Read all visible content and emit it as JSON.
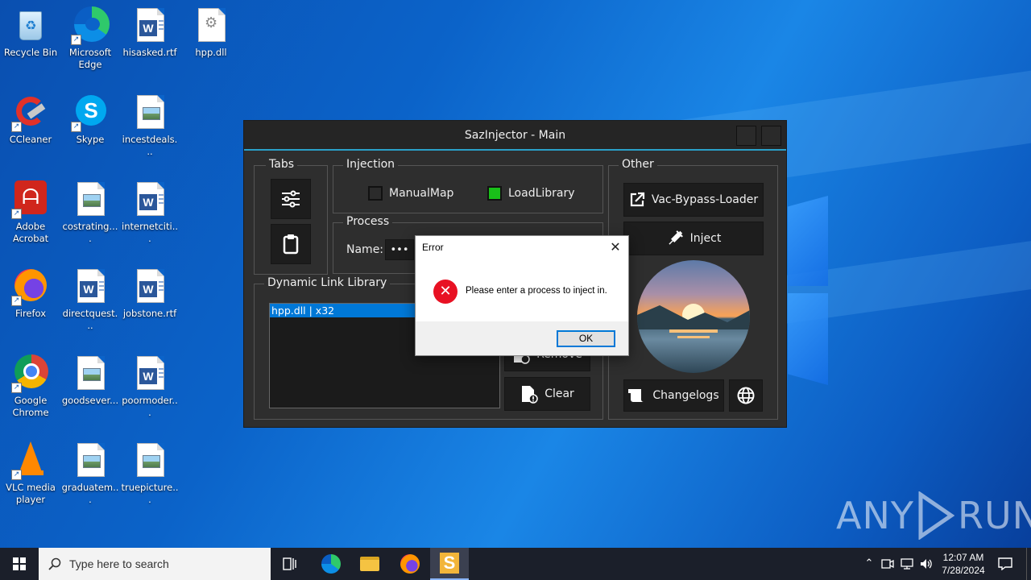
{
  "desktop": {
    "icons": [
      {
        "label": "Recycle Bin"
      },
      {
        "label": "Microsoft Edge"
      },
      {
        "label": "hisasked.rtf"
      },
      {
        "label": "hpp.dll"
      },
      {
        "label": "CCleaner"
      },
      {
        "label": "Skype"
      },
      {
        "label": "incestdeals..."
      },
      {
        "label": "Adobe Acrobat"
      },
      {
        "label": "costrating...."
      },
      {
        "label": "internetciti..."
      },
      {
        "label": "Firefox"
      },
      {
        "label": "directquest..."
      },
      {
        "label": "jobstone.rtf"
      },
      {
        "label": "Google Chrome"
      },
      {
        "label": "goodsever..."
      },
      {
        "label": "poormoder..."
      },
      {
        "label": "VLC media player"
      },
      {
        "label": "graduatem..."
      },
      {
        "label": "truepicture..."
      }
    ]
  },
  "saz": {
    "title": "SazInjector - Main",
    "tabs_title": "Tabs",
    "injection": {
      "title": "Injection",
      "manualmap": "ManualMap",
      "loadlibrary": "LoadLibrary",
      "manualmap_checked": false,
      "loadlibrary_checked": true
    },
    "process": {
      "title": "Process",
      "name_label": "Name:",
      "dots": "•••"
    },
    "dll": {
      "title": "Dynamic Link Library",
      "items": [
        "hpp.dll | x32"
      ],
      "remove": "Remove",
      "clear": "Clear"
    },
    "other": {
      "title": "Other",
      "vac": "Vac-Bypass-Loader",
      "inject": "Inject",
      "changelogs": "Changelogs"
    }
  },
  "error_dialog": {
    "title": "Error",
    "close": "✕",
    "message": "Please enter a process to inject in.",
    "ok": "OK"
  },
  "taskbar": {
    "search_placeholder": "Type here to search",
    "time": "12:07 AM",
    "date": "7/28/2024"
  },
  "watermark": {
    "left": "ANY",
    "right": "RUN"
  },
  "colors": {
    "accent": "#2aa0c8",
    "checkbox_on": "#19c019",
    "error_red": "#e81123",
    "taskbar": "#1b1f2a"
  }
}
